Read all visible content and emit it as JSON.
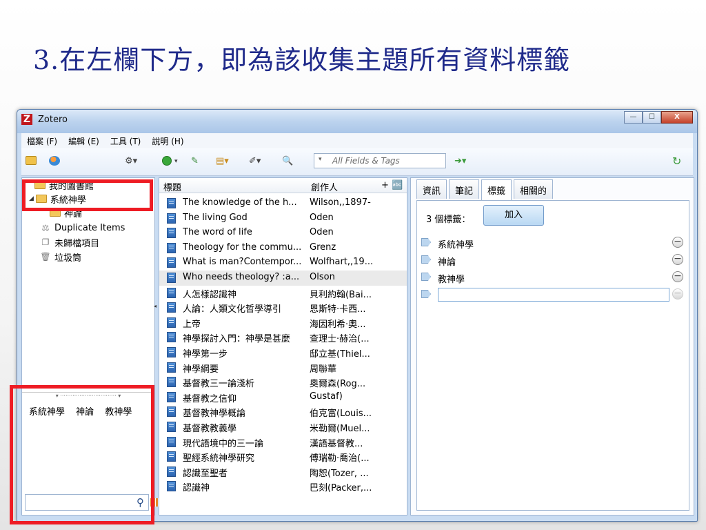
{
  "slide": {
    "title": "3.在左欄下方，即為該收集主題所有資料標籤"
  },
  "window": {
    "title": "Zotero",
    "logo": "Z",
    "btn_min": "—",
    "btn_max": "☐",
    "btn_close": "X"
  },
  "menu": [
    "檔案 (F)",
    "編輯 (E)",
    "工具 (T)",
    "說明 (H)"
  ],
  "toolbar": {
    "search_placeholder": "All Fields & Tags",
    "search_mode_icon": "▾",
    "icons": [
      "new-collection-icon",
      "new-group-icon",
      "actions-gear-icon",
      "new-item-icon",
      "add-by-identifier-icon",
      "new-note-icon",
      "attachment-icon",
      "advanced-search-icon",
      "locate-icon",
      "sync-icon"
    ]
  },
  "library": {
    "root": "我的圖書館",
    "collection": "系統神學",
    "subcollection": "神論",
    "items": [
      "Duplicate Items",
      "未歸檔項目",
      "垃圾筒"
    ]
  },
  "tag_selector": {
    "tags": [
      "系統神學",
      "神論",
      "教神學"
    ],
    "filter_placeholder": ""
  },
  "items_table": {
    "col_title": "標題",
    "col_creator": "創作人",
    "col_picker": "+ 🔤",
    "rows": [
      {
        "title": "The knowledge of the h...",
        "creator": "Wilson,,1897-"
      },
      {
        "title": "The living God",
        "creator": "Oden"
      },
      {
        "title": "The word of life",
        "creator": "Oden"
      },
      {
        "title": "Theology for the commu...",
        "creator": "Grenz"
      },
      {
        "title": "What is man?Contempor...",
        "creator": "Wolfhart,,19..."
      },
      {
        "title": "Who needs theology? :a...",
        "creator": "Olson",
        "selected": true
      },
      {
        "title": "人怎樣認識神",
        "creator": "貝利約翰(Bai..."
      },
      {
        "title": "人論：人類文化哲學導引",
        "creator": "恩斯特·卡西..."
      },
      {
        "title": "上帝",
        "creator": "海因利希·奧..."
      },
      {
        "title": "神學探討入門：神學是甚麼",
        "creator": "查理士·赫治(..."
      },
      {
        "title": "神學第一步",
        "creator": "邸立基(Thiel..."
      },
      {
        "title": "神學綱要",
        "creator": "周聯華"
      },
      {
        "title": "基督教三一論淺析",
        "creator": "奧爾森(Rog..."
      },
      {
        "title": "基督教之信仰",
        "creator": "Gustaf)"
      },
      {
        "title": "基督教神學概論",
        "creator": "伯克富(Louis..."
      },
      {
        "title": "基督教教義學",
        "creator": "米勒爾(Muel..."
      },
      {
        "title": "現代語境中的三一論",
        "creator": "漢語基督教..."
      },
      {
        "title": "聖經系統神學研究",
        "creator": "傅瑞勒·喬治(..."
      },
      {
        "title": "認識至聖者",
        "creator": "陶恕(Tozer, ..."
      },
      {
        "title": "認識神",
        "creator": "巴刻(Packer,..."
      }
    ]
  },
  "item_pane": {
    "tabs": [
      "資訊",
      "筆記",
      "標籤",
      "相關的"
    ],
    "active_tab": "標籤",
    "tag_count_label": "3 個標籤：",
    "add_button": "加入",
    "tags": [
      "系統神學",
      "神論",
      "教神學"
    ],
    "minus_symbol": "−"
  },
  "colors": {
    "highlight_box": "#ee1c24",
    "title_color": "#1f2a8a",
    "window_frame": "#c9dcf2"
  }
}
